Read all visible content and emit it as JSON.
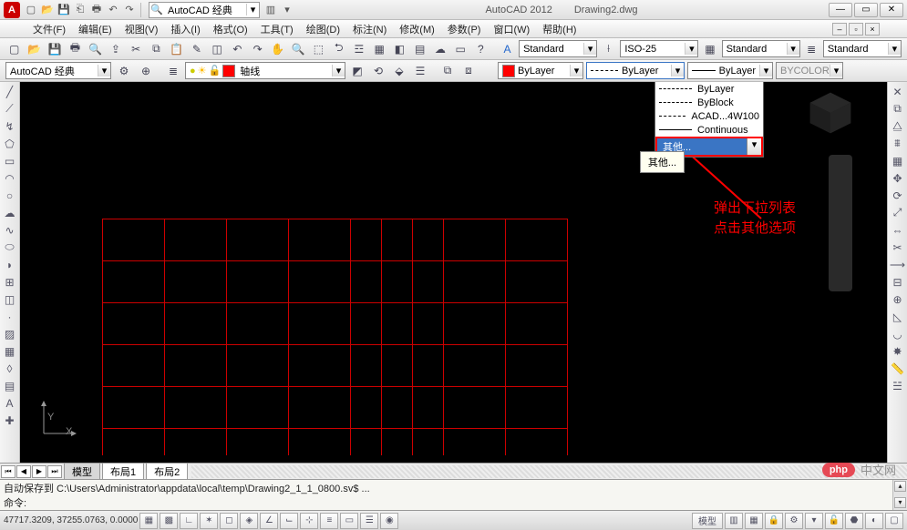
{
  "title": {
    "app": "AutoCAD 2012",
    "doc": "Drawing2.dwg"
  },
  "workspace_selector": "AutoCAD 经典",
  "menus": [
    "文件(F)",
    "编辑(E)",
    "视图(V)",
    "插入(I)",
    "格式(O)",
    "工具(T)",
    "绘图(D)",
    "标注(N)",
    "修改(M)",
    "参数(P)",
    "窗口(W)",
    "帮助(H)"
  ],
  "styles_row": {
    "textstyle": "Standard",
    "dimstyle": "ISO-25",
    "tablestyle": "Standard",
    "mlstyle": "Standard"
  },
  "props_row": {
    "workspace": "AutoCAD 经典",
    "layer": "轴线",
    "color_label": "ByLayer",
    "linetype_sel": "ByLayer",
    "lineweight": "ByLayer",
    "plotstyle": "BYCOLOR"
  },
  "linetype_dropdown": {
    "opts": [
      "ByLayer",
      "ByBlock",
      "ACAD...4W100",
      "Continuous"
    ],
    "other": "其他..."
  },
  "tooltip_other": "其他...",
  "annotation": {
    "l1": "弹出下拉列表",
    "l2": "点击其他选项"
  },
  "tabs": {
    "model": "模型",
    "layout1": "布局1",
    "layout2": "布局2"
  },
  "command": {
    "line1": "自动保存到 C:\\Users\\Administrator\\appdata\\local\\temp\\Drawing2_1_1_0800.sv$ ...",
    "line2": "命令:"
  },
  "status": {
    "coords": "47717.3209, 37255.0763, 0.0000",
    "tab_ms": "模型"
  },
  "watermark": {
    "badge": "php",
    "text": "中文网"
  },
  "ucs": {
    "x": "X",
    "y": "Y"
  }
}
